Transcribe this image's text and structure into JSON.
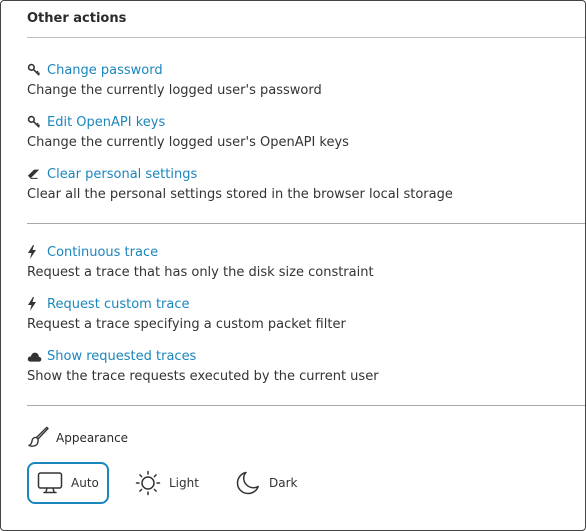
{
  "header": {
    "title": "Other actions"
  },
  "actions_group_1": [
    {
      "label": "Change password",
      "description": "Change the currently logged user's password",
      "icon": "key-icon"
    },
    {
      "label": "Edit OpenAPI keys",
      "description": "Change the currently logged user's OpenAPI keys",
      "icon": "key-icon"
    },
    {
      "label": "Clear personal settings",
      "description": "Clear all the personal settings stored in the browser local storage",
      "icon": "eraser-icon"
    }
  ],
  "actions_group_2": [
    {
      "label": "Continuous trace",
      "description": "Request a trace that has only the disk size constraint",
      "icon": "bolt-icon"
    },
    {
      "label": "Request custom trace",
      "description": "Request a trace specifying a custom packet filter",
      "icon": "bolt-icon"
    },
    {
      "label": "Show requested traces",
      "description": "Show the trace requests executed by the current user",
      "icon": "cloud-icon"
    }
  ],
  "appearance": {
    "label": "Appearance",
    "options": [
      {
        "label": "Auto",
        "icon": "monitor-icon",
        "selected": true
      },
      {
        "label": "Light",
        "icon": "sun-icon",
        "selected": false
      },
      {
        "label": "Dark",
        "icon": "moon-icon",
        "selected": false
      }
    ]
  },
  "colors": {
    "link": "#1a86bd",
    "text": "#333333",
    "divider": "#a9a9a9",
    "selected_border": "#1a86bd"
  }
}
